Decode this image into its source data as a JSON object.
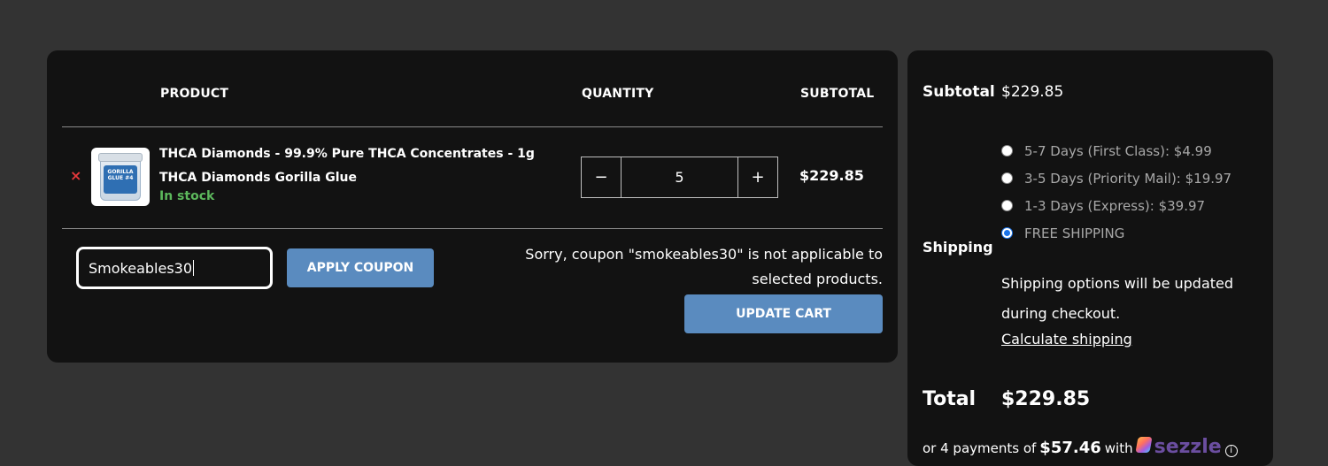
{
  "cart": {
    "headers": {
      "product": "PRODUCT",
      "quantity": "QUANTITY",
      "subtotal": "SUBTOTAL"
    },
    "item": {
      "remove": "×",
      "thumb_label": "GORILLA GLUE #4",
      "name": "THCA Diamonds - 99.9% Pure THCA Concentrates - 1g THCA Diamonds Gorilla Glue",
      "stock": "In stock",
      "qty_minus": "−",
      "qty_value": "5",
      "qty_plus": "+",
      "subtotal": "$229.85"
    },
    "coupon": {
      "value": "Smokeables30",
      "apply_label": "APPLY COUPON",
      "error": "Sorry, coupon \"smokeables30\" is not applicable to selected products.",
      "update_label": "UPDATE CART"
    }
  },
  "totals": {
    "subtotal_label": "Subtotal",
    "subtotal_value": "$229.85",
    "shipping_label": "Shipping",
    "shipping_options": [
      {
        "label": "5-7 Days (First Class): $4.99",
        "checked": false
      },
      {
        "label": "3-5 Days (Priority Mail): $19.97",
        "checked": false
      },
      {
        "label": "1-3 Days (Express): $39.97",
        "checked": false
      },
      {
        "label": "FREE SHIPPING",
        "checked": true
      }
    ],
    "shipping_note": "Shipping options will be updated during checkout.",
    "calc_link": "Calculate shipping",
    "total_label": "Total",
    "total_value": "$229.85",
    "sezzle": {
      "prefix": "or 4 payments of",
      "amount": "$57.46",
      "with": "with",
      "brand": "sezzle",
      "info": "i"
    }
  },
  "colors": {
    "page_bg": "#333333",
    "panel_bg": "#121212",
    "button_blue": "#5a8bbf",
    "stock_green": "#5cb85c",
    "remove_red": "#e5383b"
  }
}
